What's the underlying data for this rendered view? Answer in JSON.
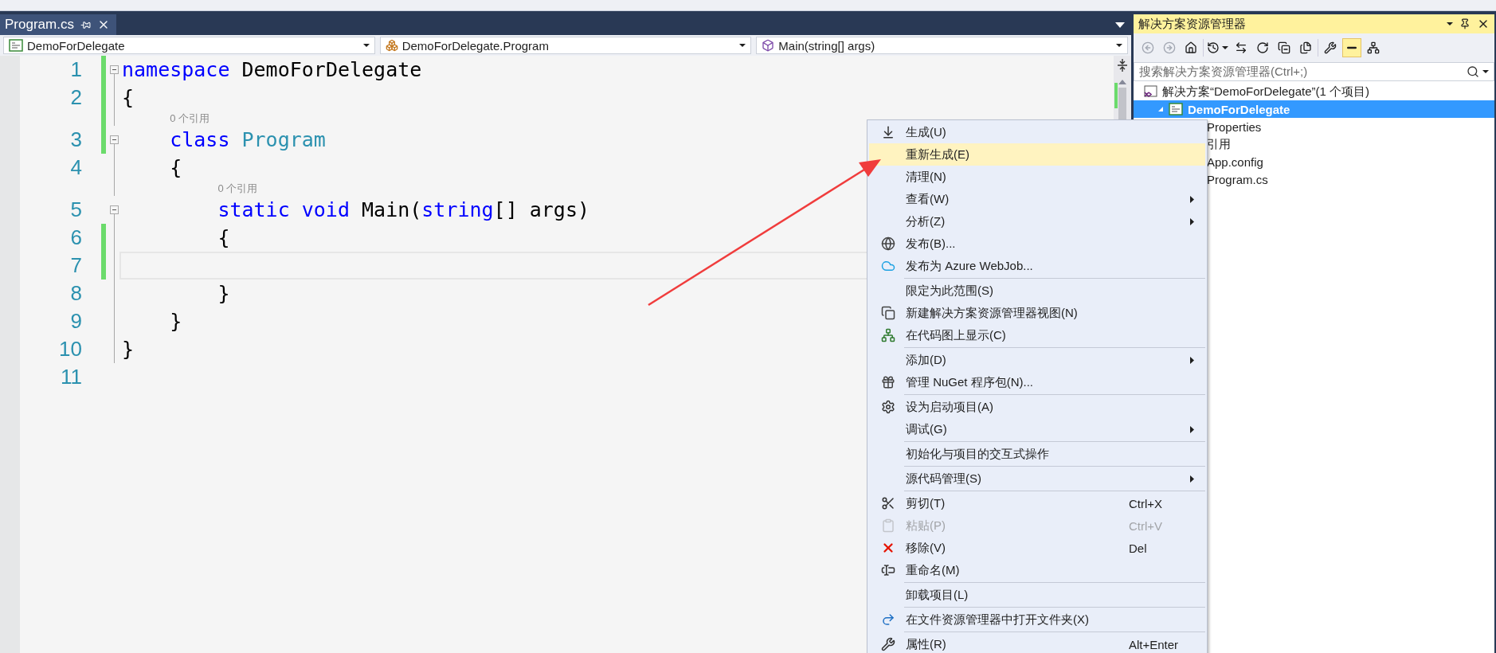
{
  "editor_tabs": [
    {
      "label": "Program.cs",
      "selected": true
    }
  ],
  "nav_dropdowns": [
    {
      "kind": "project",
      "value": "DemoForDelegate"
    },
    {
      "kind": "class",
      "value": "DemoForDelegate.Program"
    },
    {
      "kind": "method",
      "value": "Main(string[] args)"
    }
  ],
  "code_lines": [
    {
      "number": "1",
      "changed": true,
      "collapsible": true,
      "current": false,
      "tokens": [
        {
          "kind": "keyword",
          "text": "namespace"
        },
        {
          "kind": "plain",
          "text": " DemoForDelegate"
        }
      ]
    },
    {
      "number": "2",
      "changed": true,
      "collapsible": false,
      "current": false,
      "tokens": [
        {
          "kind": "plain",
          "text": "{"
        }
      ]
    },
    {
      "number": "3",
      "changed": true,
      "collapsible": true,
      "current": false,
      "codelens": "0 个引用",
      "tokens": [
        {
          "kind": "keyword",
          "text": "    class"
        },
        {
          "kind": "type",
          "text": " Program"
        }
      ]
    },
    {
      "number": "4",
      "changed": false,
      "collapsible": false,
      "current": false,
      "tokens": [
        {
          "kind": "plain",
          "text": "    {"
        }
      ]
    },
    {
      "number": "5",
      "changed": false,
      "collapsible": true,
      "current": false,
      "codelens": "0 个引用",
      "tokens": [
        {
          "kind": "keyword",
          "text": "        static void"
        },
        {
          "kind": "plain",
          "text": " Main("
        },
        {
          "kind": "keyword",
          "text": "string"
        },
        {
          "kind": "plain",
          "text": "[] args)"
        }
      ]
    },
    {
      "number": "6",
      "changed": true,
      "collapsible": false,
      "current": false,
      "tokens": [
        {
          "kind": "plain",
          "text": "        {"
        }
      ]
    },
    {
      "number": "7",
      "changed": true,
      "collapsible": false,
      "current": true
    },
    {
      "number": "8",
      "changed": false,
      "collapsible": false,
      "current": false,
      "tokens": [
        {
          "kind": "plain",
          "text": "        }"
        }
      ]
    },
    {
      "number": "9",
      "changed": false,
      "collapsible": false,
      "current": false,
      "tokens": [
        {
          "kind": "plain",
          "text": "    }"
        }
      ]
    },
    {
      "number": "10",
      "changed": false,
      "collapsible": false,
      "current": false,
      "tokens": [
        {
          "kind": "plain",
          "text": "}"
        }
      ]
    },
    {
      "number": "11",
      "changed": false,
      "collapsible": false,
      "current": false
    }
  ],
  "solution_explorer": {
    "title": "解决方案资源管理器",
    "toolbar": [
      {
        "kind": "back",
        "disabled": true,
        "on": false
      },
      {
        "kind": "forward",
        "disabled": true,
        "on": false
      },
      {
        "kind": "home",
        "disabled": false,
        "on": false
      },
      {
        "kind": "history",
        "disabled": false,
        "on": false
      },
      {
        "kind": "sync",
        "disabled": false,
        "on": false
      },
      {
        "kind": "refresh",
        "disabled": false,
        "on": false
      },
      {
        "kind": "collapse",
        "disabled": false,
        "on": false
      },
      {
        "kind": "show-all",
        "disabled": false,
        "on": false
      },
      {
        "kind": "properties",
        "disabled": false,
        "on": false
      },
      {
        "kind": "pending",
        "disabled": false,
        "on": true
      },
      {
        "kind": "diagram",
        "disabled": false,
        "on": false
      }
    ],
    "search": {
      "placeholder": "搜索解决方案资源管理器(Ctrl+;)"
    },
    "tree": [
      {
        "kind": "solution",
        "label": "解决方案“DemoForDelegate”(1 个项目)",
        "selected": false,
        "children": [
          {
            "kind": "project",
            "label": "DemoForDelegate",
            "selected": true,
            "expanded": true,
            "children": [
              {
                "kind": "file",
                "label": "Properties",
                "selected": false
              },
              {
                "kind": "file",
                "label": "引用",
                "selected": false
              },
              {
                "kind": "file",
                "label": "App.config",
                "selected": false
              },
              {
                "kind": "file",
                "label": "Program.cs",
                "selected": false
              }
            ]
          }
        ]
      }
    ]
  },
  "context_menu": {
    "items": [
      {
        "kind": "item",
        "label": "生成(U)",
        "selected": false,
        "disabled": false,
        "submenu": false
      },
      {
        "kind": "item",
        "label": "重新生成(E)",
        "selected": true,
        "disabled": false,
        "submenu": false
      },
      {
        "kind": "item",
        "label": "清理(N)",
        "selected": false,
        "disabled": false,
        "submenu": false
      },
      {
        "kind": "item",
        "label": "查看(W)",
        "selected": false,
        "disabled": false,
        "submenu": true
      },
      {
        "kind": "item",
        "label": "分析(Z)",
        "selected": false,
        "disabled": false,
        "submenu": true
      },
      {
        "kind": "item",
        "label": "发布(B)...",
        "selected": false,
        "disabled": false,
        "submenu": false
      },
      {
        "kind": "item",
        "label": "发布为 Azure WebJob...",
        "selected": false,
        "disabled": false,
        "submenu": false
      },
      {
        "kind": "separator"
      },
      {
        "kind": "item",
        "label": "限定为此范围(S)",
        "selected": false,
        "disabled": false,
        "submenu": false
      },
      {
        "kind": "item",
        "label": "新建解决方案资源管理器视图(N)",
        "selected": false,
        "disabled": false,
        "submenu": false
      },
      {
        "kind": "item",
        "label": "在代码图上显示(C)",
        "selected": false,
        "disabled": false,
        "submenu": false
      },
      {
        "kind": "separator"
      },
      {
        "kind": "item",
        "label": "添加(D)",
        "selected": false,
        "disabled": false,
        "submenu": true
      },
      {
        "kind": "item",
        "label": "管理 NuGet 程序包(N)...",
        "selected": false,
        "disabled": false,
        "submenu": false
      },
      {
        "kind": "separator"
      },
      {
        "kind": "item",
        "label": "设为启动项目(A)",
        "selected": false,
        "disabled": false,
        "submenu": false
      },
      {
        "kind": "item",
        "label": "调试(G)",
        "selected": false,
        "disabled": false,
        "submenu": true
      },
      {
        "kind": "separator"
      },
      {
        "kind": "item",
        "label": "初始化与项目的交互式操作",
        "selected": false,
        "disabled": false,
        "submenu": false
      },
      {
        "kind": "separator"
      },
      {
        "kind": "item",
        "label": "源代码管理(S)",
        "selected": false,
        "disabled": false,
        "submenu": true
      },
      {
        "kind": "separator"
      },
      {
        "kind": "item",
        "label": "剪切(T)",
        "shortcut": "Ctrl+X",
        "selected": false,
        "disabled": false,
        "submenu": false
      },
      {
        "kind": "item",
        "label": "粘贴(P)",
        "shortcut": "Ctrl+V",
        "selected": false,
        "disabled": true,
        "submenu": false
      },
      {
        "kind": "item",
        "label": "移除(V)",
        "shortcut": "Del",
        "selected": false,
        "disabled": false,
        "submenu": false
      },
      {
        "kind": "item",
        "label": "重命名(M)",
        "selected": false,
        "disabled": false,
        "submenu": false
      },
      {
        "kind": "separator"
      },
      {
        "kind": "item",
        "label": "卸载项目(L)",
        "selected": false,
        "disabled": false,
        "submenu": false
      },
      {
        "kind": "separator"
      },
      {
        "kind": "item",
        "label": "在文件资源管理器中打开文件夹(X)",
        "selected": false,
        "disabled": false,
        "submenu": false
      },
      {
        "kind": "separator"
      },
      {
        "kind": "item",
        "label": "属性(R)",
        "shortcut": "Alt+Enter",
        "selected": false,
        "disabled": false,
        "submenu": false
      }
    ]
  }
}
